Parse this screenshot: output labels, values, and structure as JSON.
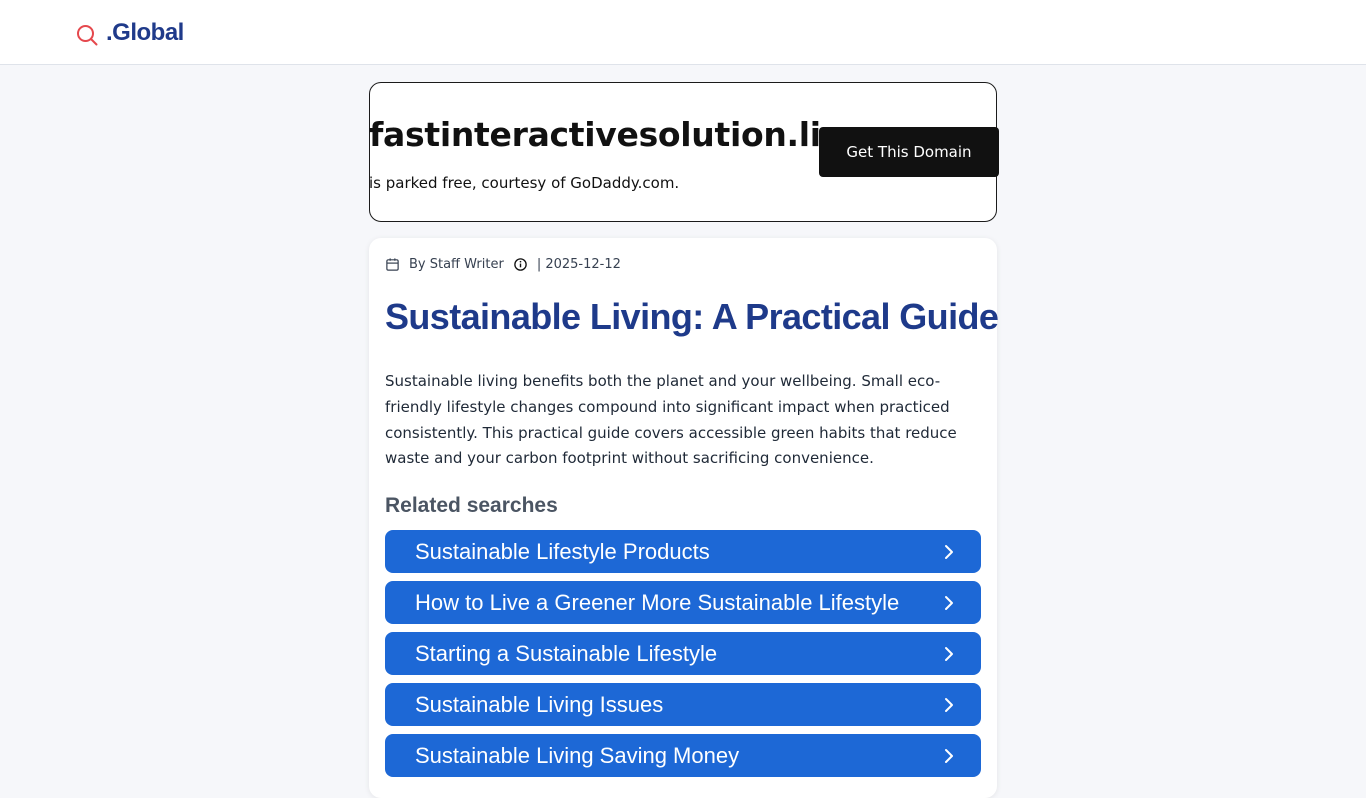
{
  "header": {
    "brand": ".Global",
    "brand_icon": "search-icon",
    "brand_icon_color": "#e5484d"
  },
  "parking": {
    "domain": "fastinteractivesolution.live",
    "subtitle": "is parked free, courtesy of GoDaddy.com.",
    "cta": "Get This Domain"
  },
  "article": {
    "author": "By Staff Writer",
    "date": "| 2025-12-12",
    "title": "Sustainable Living: A Practical Guide",
    "body": "Sustainable living benefits both the planet and your wellbeing. Small eco-friendly lifestyle changes compound into significant impact when practiced consistently. This practical guide covers accessible green habits that reduce waste and your carbon footprint without sacrificing convenience."
  },
  "related": {
    "heading": "Related searches",
    "items": [
      {
        "label": "Sustainable Lifestyle Products"
      },
      {
        "label": "How to Live a Greener More Sustainable Lifestyle"
      },
      {
        "label": "Starting a Sustainable Lifestyle"
      },
      {
        "label": "Sustainable Living Issues"
      },
      {
        "label": "Sustainable Living Saving Money"
      }
    ]
  },
  "colors": {
    "accent_blue": "#1d68d6",
    "title_blue": "#1e3a8a"
  }
}
